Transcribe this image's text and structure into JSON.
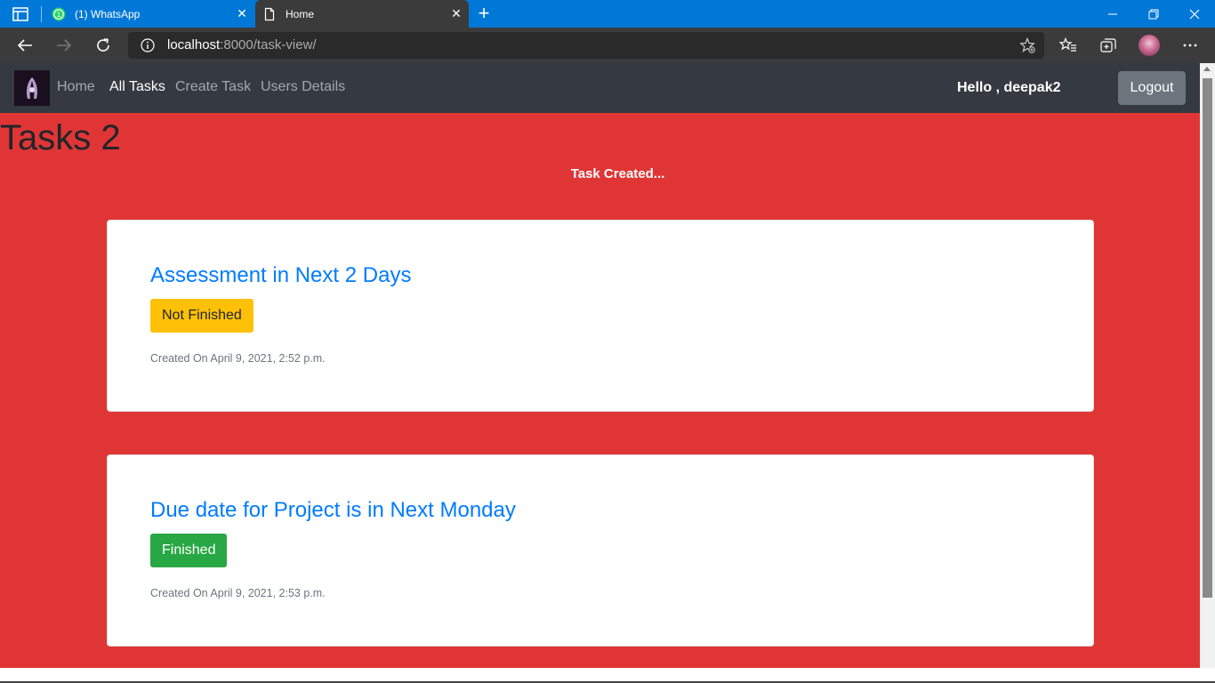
{
  "browser": {
    "tabs": [
      {
        "title": "(1) WhatsApp",
        "active": false,
        "favicon": "whatsapp-icon",
        "badge": "1"
      },
      {
        "title": "Home",
        "active": true,
        "favicon": "page-icon"
      }
    ],
    "url_host": "localhost",
    "url_rest": ":8000/task-view/",
    "accent_color": "#0078d7"
  },
  "navbar": {
    "links": [
      {
        "label": "Home",
        "active": false
      },
      {
        "label": "All Tasks",
        "active": true
      },
      {
        "label": "Create Task",
        "active": false
      },
      {
        "label": "Users Details",
        "active": false
      }
    ],
    "greeting": "Hello , deepak2",
    "logout_label": "Logout"
  },
  "page": {
    "title": "Tasks 2",
    "message": "Task Created...",
    "background_color": "#e03535"
  },
  "tasks": [
    {
      "title": "Assessment in Next 2 Days",
      "status": "Not Finished",
      "status_color": "#ffc107",
      "created": "Created On April 9, 2021, 2:52 p.m."
    },
    {
      "title": "Due date for Project is in Next Monday",
      "status": "Finished",
      "status_color": "#28a745",
      "created": "Created On April 9, 2021, 2:53 p.m."
    }
  ]
}
